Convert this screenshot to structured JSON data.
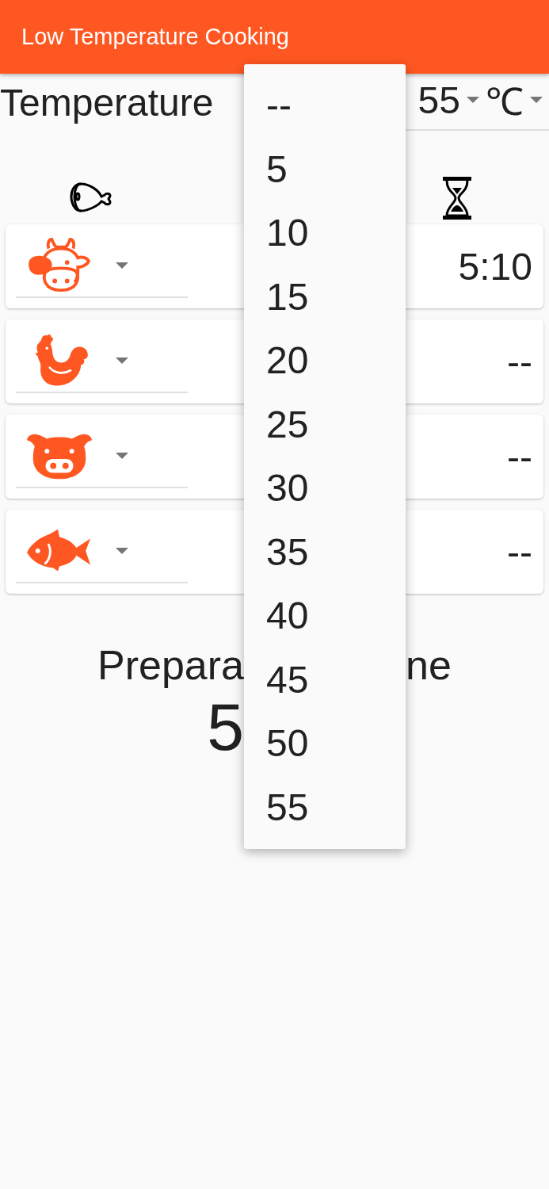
{
  "app_bar": {
    "title": "Low Temperature Cooking"
  },
  "temperature": {
    "label": "Temperature",
    "value": "55",
    "unit": "℃"
  },
  "rows": [
    {
      "kind": "cow",
      "time": "5:10"
    },
    {
      "kind": "chicken",
      "time": "--"
    },
    {
      "kind": "pig",
      "time": "--"
    },
    {
      "kind": "fish",
      "time": "--"
    }
  ],
  "preparation": {
    "label_left": "Prepara",
    "label_right": "ne",
    "value": "5"
  },
  "menu": {
    "options": [
      "--",
      "5",
      "10",
      "15",
      "20",
      "25",
      "30",
      "35",
      "40",
      "45",
      "50",
      "55"
    ]
  }
}
